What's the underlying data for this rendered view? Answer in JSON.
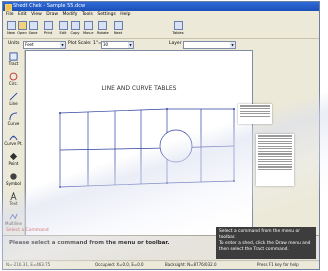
{
  "window": {
    "title": "Shedt Chek - Sample 55.dcw"
  },
  "menu": [
    "File",
    "Edit",
    "View",
    "Draw",
    "Modify",
    "Tools",
    "Settings",
    "Help"
  ],
  "toolbar": [
    "New",
    "Open",
    "Save",
    "Print",
    "Edit",
    "Copy",
    "Mov.e",
    "Rotate",
    "Next"
  ],
  "toolbar_extra": "Tables",
  "options": {
    "units_label": "Units",
    "units_value": "Feet",
    "plot_scale_label": "Plot Scale: 1\"=",
    "plot_scale_value": "30",
    "layer_label": "Layer"
  },
  "left_tools": [
    "Tract",
    "Circ.",
    "Line",
    "Curve",
    "Curve Pt.",
    "Point",
    "Symbol",
    "Text",
    "Multiline"
  ],
  "drawing": {
    "title": "LINE AND CURVE TABLES"
  },
  "command": {
    "header": "Select a Command",
    "prompt": "Please select a command from the menu or toolbar.",
    "help_lines": [
      "Select a command from the menu or toolbar.",
      "To enter a shed, click the Draw menu and",
      "then select the Tract command."
    ]
  },
  "status": {
    "coords": "N=-216.31, E=463.75",
    "occupied": "Occupied: X=0.0, E=0.0",
    "backsight": "Backsight: N=8776/032.0",
    "help_hint": "Press F1 key for help"
  },
  "colors": {
    "titlebar": "#1b4fb8",
    "cmd_header": "#c01010",
    "parcel_lines": "#3040a0",
    "help_bg": "#3d3d3d"
  }
}
